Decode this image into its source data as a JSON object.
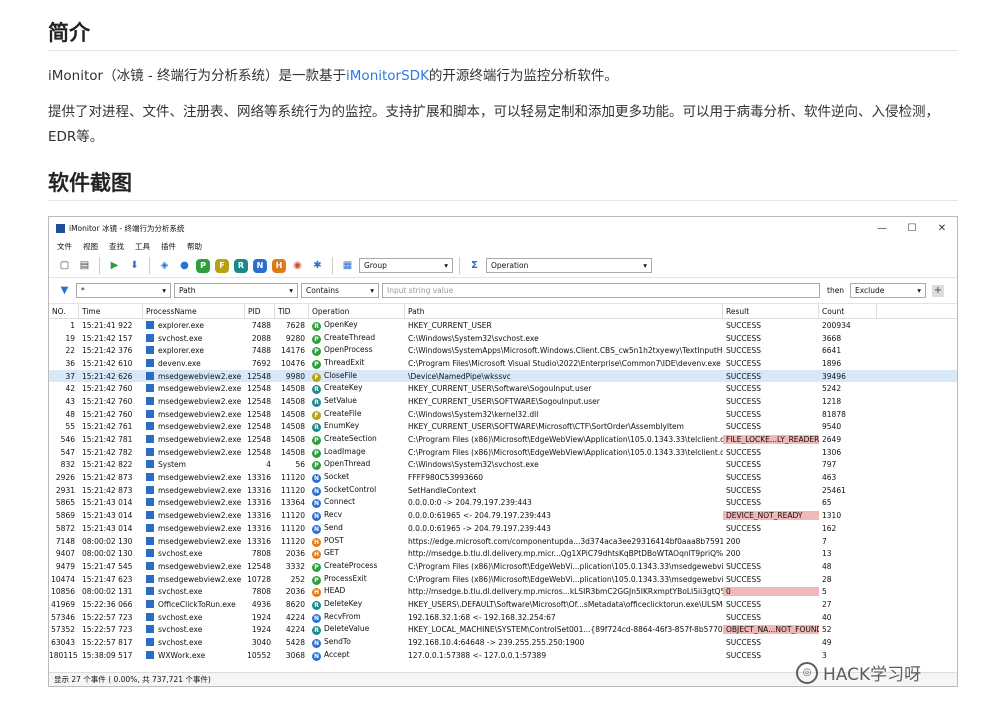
{
  "article": {
    "heading1": "简介",
    "p1_pre": "iMonitor（冰镜 - 终端行为分析系统）是一款基于",
    "p1_link": "iMonitorSDK",
    "p1_post": "的开源终端行为监控分析软件。",
    "p2": "提供了对进程、文件、注册表、网络等系统行为的监控。支持扩展和脚本，可以轻易定制和添加更多功能。可以用于病毒分析、软件逆向、入侵检测，EDR等。",
    "heading2": "软件截图"
  },
  "app": {
    "title": "iMonitor 冰镜 - 终端行为分析系统",
    "win_min": "—",
    "win_max": "☐",
    "win_close": "✕",
    "menu": [
      "文件",
      "视图",
      "查找",
      "工具",
      "插件",
      "帮助"
    ],
    "toolbar_letters": [
      {
        "t": "P",
        "c": "#2e9e3e"
      },
      {
        "t": "F",
        "c": "#b5a215"
      },
      {
        "t": "R",
        "c": "#1b8a8a"
      },
      {
        "t": "N",
        "c": "#2a6fd1"
      },
      {
        "t": "H",
        "c": "#e07a16"
      }
    ],
    "group_label": "Group",
    "operation_label": "Operation",
    "filter": {
      "col1": "*",
      "col2": "Path",
      "col3": "Contains",
      "input_placeholder": "Input string value",
      "then": "then",
      "action": "Exclude",
      "add": "+"
    },
    "columns": [
      "NO.",
      "Time",
      "ProcessName",
      "PID",
      "TID",
      "Operation",
      "Path",
      "Result",
      "Count"
    ],
    "rows": [
      {
        "no": "1",
        "time": "15:21:41 922",
        "proc": "explorer.exe",
        "pid": "7488",
        "tid": "7628",
        "op": "OpenKey",
        "oc": "#2e9e3e",
        "ol": "R",
        "path": "HKEY_CURRENT_USER",
        "res": "SUCCESS",
        "cnt": "200934"
      },
      {
        "no": "19",
        "time": "15:21:42 157",
        "proc": "svchost.exe",
        "pid": "2088",
        "tid": "9280",
        "op": "CreateThread",
        "oc": "#2e9e3e",
        "ol": "P",
        "path": "C:\\Windows\\System32\\svchost.exe",
        "res": "SUCCESS",
        "cnt": "3668"
      },
      {
        "no": "22",
        "time": "15:21:42 376",
        "proc": "explorer.exe",
        "pid": "7488",
        "tid": "14176",
        "op": "OpenProcess",
        "oc": "#2e9e3e",
        "ol": "P",
        "path": "C:\\Windows\\SystemApps\\Microsoft.Windows.Client.CBS_cw5n1h2txyewy\\TextInputHost.exe",
        "res": "SUCCESS",
        "cnt": "6641"
      },
      {
        "no": "36",
        "time": "15:21:42 610",
        "proc": "devenv.exe",
        "pid": "7692",
        "tid": "10476",
        "op": "ThreadExit",
        "oc": "#2e9e3e",
        "ol": "P",
        "path": "C:\\Program Files\\Microsoft Visual Studio\\2022\\Enterprise\\Common7\\IDE\\devenv.exe",
        "res": "SUCCESS",
        "cnt": "1896"
      },
      {
        "no": "37",
        "time": "15:21:42 626",
        "proc": "msedgewebview2.exe",
        "pid": "12548",
        "tid": "9980",
        "op": "CloseFile",
        "oc": "#b5a215",
        "ol": "F",
        "path": "\\Device\\NamedPipe\\wkssvc",
        "res": "SUCCESS",
        "cnt": "39496"
      },
      {
        "no": "42",
        "time": "15:21:42 760",
        "proc": "msedgewebview2.exe",
        "pid": "12548",
        "tid": "14508",
        "op": "CreateKey",
        "oc": "#1b8a8a",
        "ol": "R",
        "path": "HKEY_CURRENT_USER\\Software\\SogouInput.user",
        "res": "SUCCESS",
        "cnt": "5242"
      },
      {
        "no": "43",
        "time": "15:21:42 760",
        "proc": "msedgewebview2.exe",
        "pid": "12548",
        "tid": "14508",
        "op": "SetValue",
        "oc": "#1b8a8a",
        "ol": "R",
        "path": "HKEY_CURRENT_USER\\SOFTWARE\\SogouInput.user",
        "res": "SUCCESS",
        "cnt": "1218"
      },
      {
        "no": "48",
        "time": "15:21:42 760",
        "proc": "msedgewebview2.exe",
        "pid": "12548",
        "tid": "14508",
        "op": "CreateFile",
        "oc": "#b5a215",
        "ol": "F",
        "path": "C:\\Windows\\System32\\kernel32.dll",
        "res": "SUCCESS",
        "cnt": "81878"
      },
      {
        "no": "55",
        "time": "15:21:42 761",
        "proc": "msedgewebview2.exe",
        "pid": "12548",
        "tid": "14508",
        "op": "EnumKey",
        "oc": "#1b8a8a",
        "ol": "R",
        "path": "HKEY_CURRENT_USER\\SOFTWARE\\Microsoft\\CTF\\SortOrder\\AssemblyItem",
        "res": "SUCCESS",
        "cnt": "9540"
      },
      {
        "no": "546",
        "time": "15:21:42 781",
        "proc": "msedgewebview2.exe",
        "pid": "12548",
        "tid": "14508",
        "op": "CreateSection",
        "oc": "#2e9e3e",
        "ol": "P",
        "path": "C:\\Program Files (x86)\\Microsoft\\EdgeWebView\\Application\\105.0.1343.33\\telclient.dll",
        "res": "FILE_LOCKE...LY_READERS",
        "bad": true,
        "cnt": "2649"
      },
      {
        "no": "547",
        "time": "15:21:42 782",
        "proc": "msedgewebview2.exe",
        "pid": "12548",
        "tid": "14508",
        "op": "LoadImage",
        "oc": "#2e9e3e",
        "ol": "P",
        "path": "C:\\Program Files (x86)\\Microsoft\\EdgeWebView\\Application\\105.0.1343.33\\telclient.dll",
        "res": "SUCCESS",
        "cnt": "1306"
      },
      {
        "no": "832",
        "time": "15:21:42 822",
        "proc": "System",
        "pid": "4",
        "tid": "56",
        "op": "OpenThread",
        "oc": "#2e9e3e",
        "ol": "P",
        "path": "C:\\Windows\\System32\\svchost.exe",
        "res": "SUCCESS",
        "cnt": "797"
      },
      {
        "no": "2926",
        "time": "15:21:42 873",
        "proc": "msedgewebview2.exe",
        "pid": "13316",
        "tid": "11120",
        "op": "Socket",
        "oc": "#2a6fd1",
        "ol": "N",
        "path": "FFFF980C53993660",
        "res": "SUCCESS",
        "cnt": "463"
      },
      {
        "no": "2931",
        "time": "15:21:42 873",
        "proc": "msedgewebview2.exe",
        "pid": "13316",
        "tid": "11120",
        "op": "SocketControl",
        "oc": "#2a6fd1",
        "ol": "N",
        "path": "SetHandleContext",
        "res": "SUCCESS",
        "cnt": "25461"
      },
      {
        "no": "5865",
        "time": "15:21:43 014",
        "proc": "msedgewebview2.exe",
        "pid": "13316",
        "tid": "13364",
        "op": "Connect",
        "oc": "#2a6fd1",
        "ol": "N",
        "path": "0.0.0.0:0 -> 204.79.197.239:443",
        "res": "SUCCESS",
        "cnt": "65"
      },
      {
        "no": "5869",
        "time": "15:21:43 014",
        "proc": "msedgewebview2.exe",
        "pid": "13316",
        "tid": "11120",
        "op": "Recv",
        "oc": "#2a6fd1",
        "ol": "N",
        "path": "0.0.0.0:61965 <- 204.79.197.239:443",
        "res": "DEVICE_NOT_READY",
        "bad": true,
        "cnt": "1310"
      },
      {
        "no": "5872",
        "time": "15:21:43 014",
        "proc": "msedgewebview2.exe",
        "pid": "13316",
        "tid": "11120",
        "op": "Send",
        "oc": "#2a6fd1",
        "ol": "N",
        "path": "0.0.0.0:61965 -> 204.79.197.239:443",
        "res": "SUCCESS",
        "cnt": "162"
      },
      {
        "no": "7148",
        "time": "08:00:02 130",
        "proc": "msedgewebview2.exe",
        "pid": "13316",
        "tid": "11120",
        "op": "POST",
        "oc": "#e07a16",
        "ol": "H",
        "path": "https://edge.microsoft.com/componentupda...3d374aca3ee29316414bf0aaa8b75915ac789698",
        "res": "200",
        "cnt": "7"
      },
      {
        "no": "9407",
        "time": "08:00:02 130",
        "proc": "svchost.exe",
        "pid": "7808",
        "tid": "2036",
        "op": "GET",
        "oc": "#e07a16",
        "ol": "H",
        "path": "http://msedge.b.tlu.dl.delivery.mp.micr...Qg1XPiC79dhtsKqBPtDBoWTAOqnIT9priQ%3d%3d",
        "res": "200",
        "cnt": "13"
      },
      {
        "no": "9479",
        "time": "15:21:47 545",
        "proc": "msedgewebview2.exe",
        "pid": "12548",
        "tid": "3332",
        "op": "CreateProcess",
        "oc": "#2e9e3e",
        "ol": "P",
        "path": "C:\\Program Files (x86)\\Microsoft\\EdgeWebVi...plication\\105.0.1343.33\\msedgewebview2.exe",
        "res": "SUCCESS",
        "cnt": "48"
      },
      {
        "no": "10474",
        "time": "15:21:47 623",
        "proc": "msedgewebview2.exe",
        "pid": "10728",
        "tid": "252",
        "op": "ProcessExit",
        "oc": "#2e9e3e",
        "ol": "P",
        "path": "C:\\Program Files (x86)\\Microsoft\\EdgeWebVi...plication\\105.0.1343.33\\msedgewebview2.exe",
        "res": "SUCCESS",
        "cnt": "28"
      },
      {
        "no": "10856",
        "time": "08:00:02 131",
        "proc": "svchost.exe",
        "pid": "7808",
        "tid": "2036",
        "op": "HEAD",
        "oc": "#e07a16",
        "ol": "H",
        "path": "http://msedge.b.tlu.dl.delivery.mp.micros...kLSIR3bmC2GGJn5IKRxmptYBoLI5ii3gtQ%3d%3d",
        "res": "0",
        "bad": true,
        "cnt": "5"
      },
      {
        "no": "41969",
        "time": "15:22:36 066",
        "proc": "OfficeClickToRun.exe",
        "pid": "4936",
        "tid": "8620",
        "op": "DeleteKey",
        "oc": "#1b8a8a",
        "ol": "R",
        "path": "HKEY_USERS\\.DEFAULT\\Software\\Microsoft\\Of...sMetadata\\officeclicktorun.exe\\ULSMonitor",
        "res": "SUCCESS",
        "cnt": "27"
      },
      {
        "no": "57346",
        "time": "15:22:57 723",
        "proc": "svchost.exe",
        "pid": "1924",
        "tid": "4224",
        "op": "RecvFrom",
        "oc": "#2a6fd1",
        "ol": "N",
        "path": "192.168.32.1:68 <- 192.168.32.254:67",
        "res": "SUCCESS",
        "cnt": "40"
      },
      {
        "no": "57352",
        "time": "15:22:57 723",
        "proc": "svchost.exe",
        "pid": "1924",
        "tid": "4224",
        "op": "DeleteValue",
        "oc": "#1b8a8a",
        "ol": "R",
        "path": "HKEY_LOCAL_MACHINE\\SYSTEM\\ControlSet001...{89f724cd-8864-46f3-857f-8b57706ebc93}",
        "res": "OBJECT_NA...NOT_FOUND",
        "bad": true,
        "cnt": "52"
      },
      {
        "no": "63043",
        "time": "15:22:57 817",
        "proc": "svchost.exe",
        "pid": "3040",
        "tid": "5428",
        "op": "SendTo",
        "oc": "#2a6fd1",
        "ol": "N",
        "path": "192.168.10.4:64648 -> 239.255.255.250:1900",
        "res": "SUCCESS",
        "cnt": "49"
      },
      {
        "no": "180115",
        "time": "15:38:09 517",
        "proc": "WXWork.exe",
        "pid": "10552",
        "tid": "3068",
        "op": "Accept",
        "oc": "#2a6fd1",
        "ol": "N",
        "path": "127.0.0.1:57388 <- 127.0.0.1:57389",
        "res": "SUCCESS",
        "cnt": "3"
      }
    ],
    "status": "显示 27 个事件 ( 0.00%, 共 737,721 个事件)"
  },
  "watermark": "HACK学习呀"
}
